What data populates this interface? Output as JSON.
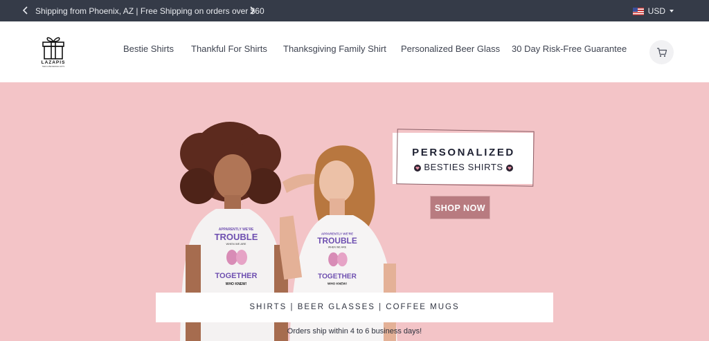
{
  "announcement": {
    "text": "Shipping from Phoenix, AZ | Free Shipping on orders over $60",
    "prev_icon": "chevron-left-icon",
    "next_icon": "chevron-right-icon"
  },
  "currency": {
    "label": "USD",
    "flag_icon": "us-flag-icon"
  },
  "logo": {
    "text": "LAZAPIS",
    "tagline": "TEES & BEVERAGE GIFTS",
    "icon": "gift-box-icon"
  },
  "nav": {
    "items": [
      {
        "label": "Bestie Shirts"
      },
      {
        "label": "Thankful For Shirts"
      },
      {
        "label": "Thanksgiving Family Shirt"
      },
      {
        "label": "Personalized Beer Glass"
      },
      {
        "label": "30 Day Risk-Free Guarantee"
      }
    ],
    "cart_icon": "cart-icon"
  },
  "hero": {
    "badge_line1": "PERSONALIZED",
    "badge_line2": "BESTIES SHIRTS",
    "shop_button": "SHOP NOW",
    "categories": "SHIRTS | BEER GLASSES | COFFEE MUGS",
    "shipping_note": "Orders ship within 4 to 6 business days!",
    "shirt_print": {
      "line1": "APPARENTLY WE'RE",
      "line2": "TROUBLE",
      "line3": "WHEN WE ARE",
      "line4": "TOGETHER",
      "line5": "WHO KNEW!"
    }
  },
  "colors": {
    "topbar": "#353b48",
    "hero_bg": "#f3c4c7",
    "button": "#b87b80",
    "print_purple": "#6e4fb0"
  }
}
